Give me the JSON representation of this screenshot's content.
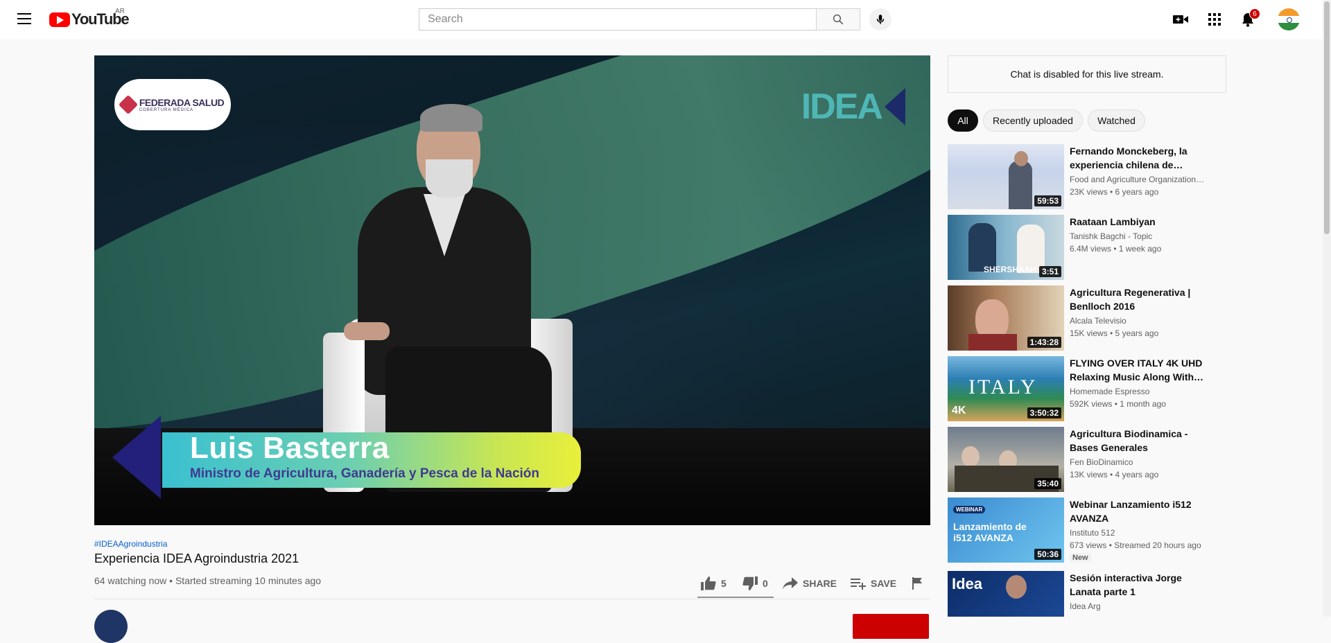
{
  "masthead": {
    "logo_text": "YouTube",
    "region": "AR",
    "search_placeholder": "Search",
    "notification_count": "6",
    "icons": [
      "menu-icon",
      "search-icon",
      "mic-icon",
      "create-video-icon",
      "apps-icon",
      "bell-icon",
      "avatar"
    ]
  },
  "player": {
    "sponsor_name": "FEDERADA SALUD",
    "sponsor_tagline": "COBERTURA MÉDICA",
    "brand_logo": "IDEA",
    "lower_third_name": "Luis Basterra",
    "lower_third_role": "Ministro de Agricultura, Ganadería y Pesca de la Nación"
  },
  "video": {
    "hashtag": "#IDEAAgroindustria",
    "title": "Experiencia IDEA Agroindustria 2021",
    "meta": "64 watching now • Started streaming 10 minutes ago",
    "likes": "5",
    "dislikes": "0",
    "share_label": "SHARE",
    "save_label": "SAVE"
  },
  "sidebar": {
    "chat_disabled": "Chat is disabled for this live stream.",
    "chips": [
      "All",
      "Recently uploaded",
      "Watched"
    ],
    "active_chip": "All",
    "recommendations": [
      {
        "title": "Fernando Monckeberg, la experiencia chilena de…",
        "channel": "Food and Agriculture Organization…",
        "stats": "23K views • 6 years ago",
        "duration": "59:53"
      },
      {
        "title": "Raataan Lambiyan",
        "channel": "Tanishk Bagchi - Topic",
        "stats": "6.4M views • 1 week ago",
        "duration": "3:51"
      },
      {
        "title": "Agricultura Regenerativa | Benlloch 2016",
        "channel": "Alcala Televisio",
        "stats": "15K views • 5 years ago",
        "duration": "1:43:28"
      },
      {
        "title": "FLYING OVER ITALY 4K UHD Relaxing Music Along With…",
        "channel": "Homemade Espresso",
        "stats": "592K views • 1 month ago",
        "duration": "3:50:32"
      },
      {
        "title": "Agricultura Biodinamica - Bases Generales",
        "channel": "Fen BioDinamico",
        "stats": "13K views • 4 years ago",
        "duration": "35:40"
      },
      {
        "title": "Webinar Lanzamiento i512 AVANZA",
        "channel": "Instituto 512",
        "stats": "673 views • Streamed 20 hours ago",
        "duration": "50:36",
        "badge": "New"
      },
      {
        "title": "Sesión interactiva Jorge Lanata parte 1",
        "channel": "Idea Arg",
        "stats": "",
        "duration": ""
      }
    ],
    "thumb_texts": [
      "SHERSHAAH",
      "ITALY",
      "4K",
      "WEBINAR",
      "Lanzamiento de i512 AVANZA",
      "Idea"
    ]
  }
}
